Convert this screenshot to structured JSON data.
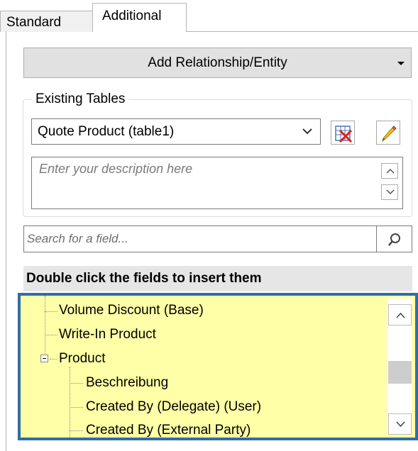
{
  "tabs": {
    "standard": "Standard",
    "additional": "Additional"
  },
  "add_relationship": {
    "label": "Add Relationship/Entity"
  },
  "existing_tables": {
    "title": "Existing  Tables",
    "selected": "Quote Product  (table1)",
    "description_placeholder": "Enter your description here"
  },
  "search": {
    "placeholder": "Search for a field..."
  },
  "instruction": "Double click the fields to insert them",
  "tree": {
    "items": [
      {
        "label": "Volume Discount (Base)"
      },
      {
        "label": "Write-In Product"
      },
      {
        "label": "Product"
      },
      {
        "label": "Beschreibung"
      },
      {
        "label": "Created By (Delegate) (User)"
      },
      {
        "label": "Created By (External Party)"
      }
    ]
  },
  "colors": {
    "tree_bg": "#ffffa8",
    "highlight_border": "#2f6fa3"
  }
}
